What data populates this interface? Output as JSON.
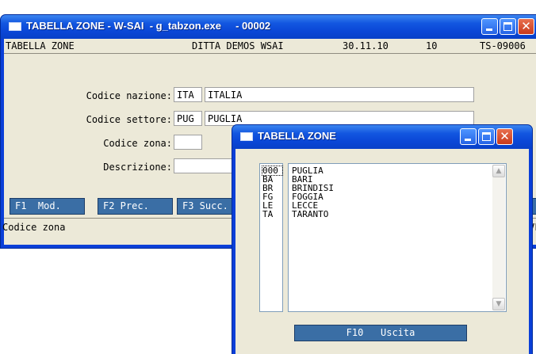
{
  "main_window": {
    "title": "TABELLA ZONE - W-SAI  - g_tabzon.exe     - 00002",
    "header": {
      "screen_name": "TABELLA ZONE",
      "company": "DITTA DEMOS WSAI",
      "date": "30.11.10",
      "terminal": "10",
      "screen_code": "TS-09006"
    },
    "form": {
      "country_label": "Codice nazione:",
      "country_code": "ITA",
      "country_name": "ITALIA",
      "sector_label": "Codice settore:",
      "sector_code": "PUG",
      "sector_name": "PUGLIA",
      "zone_label": "Codice zona:",
      "zone_value": "",
      "description_label": "Descrizione:",
      "description_value": ""
    },
    "function_keys": {
      "f1": "F1  Mod.",
      "f2": "F2 Prec.",
      "f3": "F3 Succ."
    },
    "status_text": "Codice zona",
    "status_right_fragment": "VF"
  },
  "popup_window": {
    "title": "TABELLA ZONE",
    "codes": [
      "000",
      "BA",
      "BR",
      "FG",
      "LE",
      "TA"
    ],
    "names": [
      "PUGLIA",
      "BARI",
      "BRINDISI",
      "FOGGIA",
      "LECCE",
      "TARANTO"
    ],
    "exit_button": "F10   Uscita"
  },
  "colors": {
    "titlebar_blue": "#0a46d6",
    "dialog_face": "#ece9d8",
    "function_key_blue": "#3a6ea5",
    "close_button_red": "#c93a1c"
  }
}
